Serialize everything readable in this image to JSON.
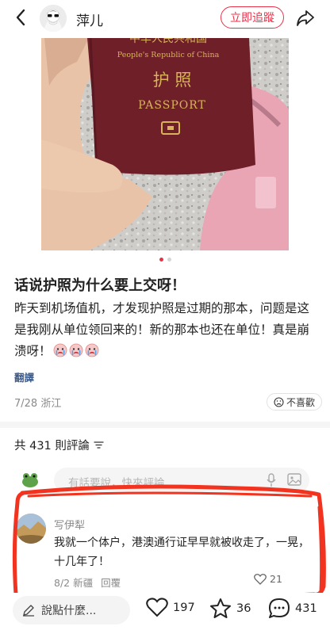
{
  "header": {
    "username": "萍儿",
    "follow_label": "立即追蹤"
  },
  "photo": {
    "passport_country_cn": "中华人民共和国",
    "passport_country_en": "People's Republic of China",
    "passport_title_cn": "护 照",
    "passport_title_en": "PASSPORT",
    "carousel_total": 2,
    "carousel_active": 1
  },
  "post": {
    "title": "话说护照为什么要上交呀！",
    "body": "昨天到机场值机，才发现护照是过期的那本，问题是这是我刚从单位领回来的！新的那本也还在单位！真是崩溃呀！",
    "emoji": [
      "crying-face",
      "crying-face",
      "crying-face"
    ],
    "translate_label": "翻譯",
    "date": "7/28",
    "location": "浙江",
    "dislike_label": "不喜歡"
  },
  "comments": {
    "count_label": "共 431 則評論",
    "input_placeholder": "有話要說，快來評論",
    "items": [
      {
        "author": "写伊犁",
        "text": "我就一个体户，港澳通行证早早就被收走了，一晃，十几年了！",
        "date": "8/2",
        "location": "新疆",
        "reply_label": "回覆",
        "likes": "21"
      }
    ]
  },
  "bottom_bar": {
    "input_label": "說點什麼...",
    "likes": "197",
    "favorites": "36",
    "comments": "431"
  },
  "colors": {
    "accent": "#e8324a",
    "annotation": "#f2331f",
    "passport": "#6e1f28",
    "gold": "#d9b35a"
  }
}
